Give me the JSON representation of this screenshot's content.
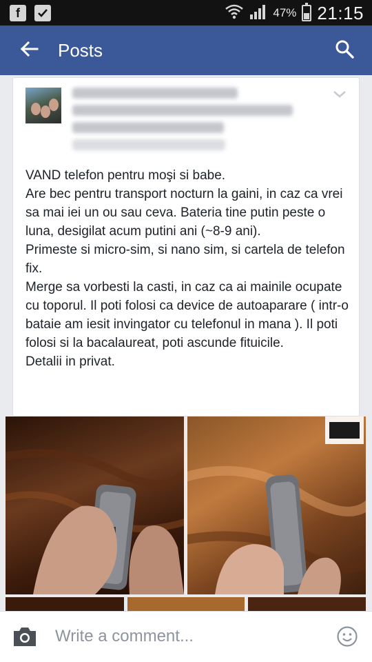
{
  "status_bar": {
    "battery_percent": "47%",
    "battery_level": 0.47,
    "time": "21:15",
    "left_icons": [
      "facebook-icon",
      "clipboard-check-icon"
    ],
    "right_icons": [
      "wifi-icon",
      "signal-icon",
      "battery-icon"
    ]
  },
  "app_bar": {
    "title": "Posts",
    "back_icon": "arrow-left-icon",
    "search_icon": "search-icon",
    "color": "#3b5998"
  },
  "post": {
    "menu_icon": "chevron-down-icon",
    "text": "VAND telefon pentru moşi si babe.\nAre bec pentru transport nocturn la gaini, in caz ca vrei sa mai iei un ou sau ceva. Bateria tine putin peste o luna, desigilat acum putini ani (~8-9 ani).\nPrimeste si micro-sim, si nano sim, si cartela de telefon fix.\nMerge sa vorbesti la casti, in caz ca ai mainile ocupate cu toporul. Il poti folosi ca device de autoaparare ( intr-o bataie am iesit invingator cu telefonul in mana ). Il poti folosi si la bacalaureat, poti ascunde fituicile.\nDetalii in privat."
  },
  "comment_bar": {
    "placeholder": "Write a comment...",
    "camera_icon": "camera-icon",
    "emoji_icon": "smiley-icon"
  },
  "colors": {
    "brand": "#3b5998",
    "text": "#1d2129",
    "placeholder": "#8d949e"
  }
}
